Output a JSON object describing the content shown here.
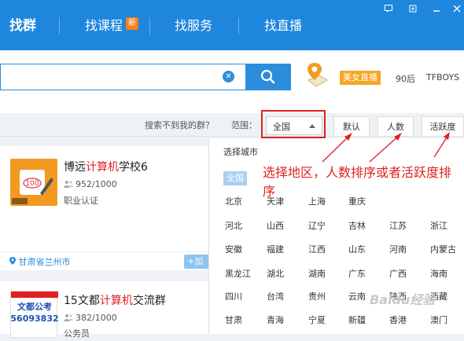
{
  "tabs": [
    {
      "label": "找群",
      "active": true
    },
    {
      "label": "找课程",
      "active": false
    },
    {
      "label": "找服务",
      "active": false
    },
    {
      "label": "找直播",
      "active": false
    }
  ],
  "new_badge": "新",
  "search": {
    "placeholder": "",
    "clear_icon": "clear-icon",
    "button_icon": "search-icon"
  },
  "promo": {
    "live_badge": "美女直播",
    "hot_tags": [
      "90后",
      "TFBOYS"
    ]
  },
  "filter": {
    "not_found_text": "搜索不到我的群？",
    "range_label": "范围：",
    "region_value": "全国",
    "sort_buttons": [
      "默认",
      "人数",
      "活跃度"
    ]
  },
  "cards": [
    {
      "title_prefix": "博远",
      "title_highlight": "计算机",
      "title_suffix": "学校6",
      "count": "952/1000",
      "type": "职业认证",
      "location": "甘肃省兰州市",
      "add_label": "+加"
    },
    {
      "title_prefix": "15文都",
      "title_highlight": "计算机",
      "title_suffix": "交流群",
      "count": "382/1000",
      "type": "公务员",
      "logo_text_line1": "文都公考",
      "logo_text_line2": "56093832"
    }
  ],
  "dropdown": {
    "title": "选择城市",
    "all_label": "全国",
    "cities": [
      [
        "北京",
        "天津",
        "上海",
        "重庆"
      ],
      [
        "河北",
        "山西",
        "辽宁",
        "吉林",
        "江苏",
        "浙江"
      ],
      [
        "安徽",
        "福建",
        "江西",
        "山东",
        "河南",
        "内蒙古"
      ],
      [
        "黑龙江",
        "湖北",
        "湖南",
        "广东",
        "广西",
        "海南"
      ],
      [
        "四川",
        "台湾",
        "贵州",
        "云南",
        "陕西",
        "西藏"
      ],
      [
        "甘肃",
        "青海",
        "宁夏",
        "新疆",
        "香港",
        "澳门"
      ]
    ]
  },
  "annotation": "选择地区，人数排序或者活跃度排序",
  "watermark": "Baidu经验",
  "colors": {
    "topbar": "#1f86de",
    "accent": "#2d8cdc",
    "highlight": "#e02020",
    "badge": "#f6811f"
  }
}
